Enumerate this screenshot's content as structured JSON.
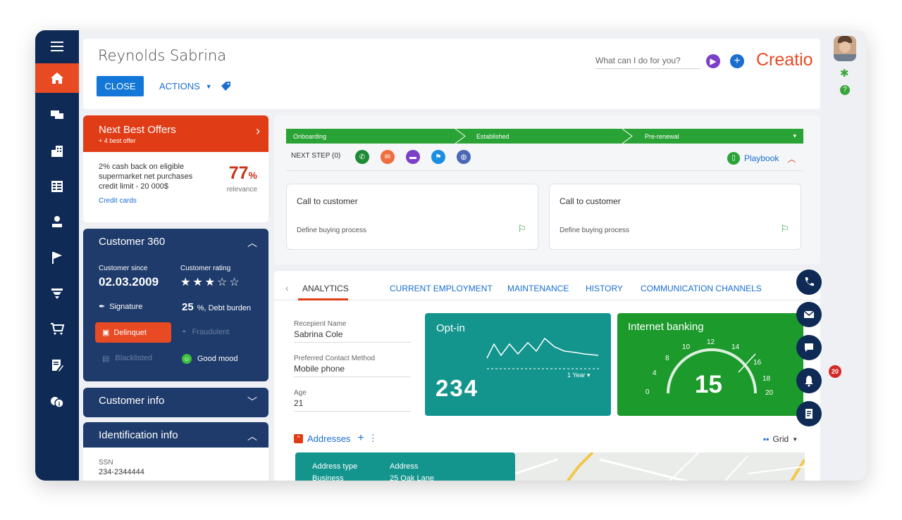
{
  "header": {
    "record_title": "Reynolds Sabrina",
    "close_label": "CLOSE",
    "actions_label": "ACTIONS",
    "search_placeholder": "What can I do for you?",
    "brand": "Creatio"
  },
  "nav": {
    "items": [
      "menu-icon",
      "home-icon",
      "feed-icon",
      "accounts-icon",
      "contacts-list-icon",
      "contact-icon",
      "flag-icon",
      "filter-icon",
      "cart-icon",
      "document-edit-icon",
      "dollar-icon"
    ],
    "active": "home-icon"
  },
  "next_best_offers": {
    "title": "Next Best Offers",
    "subtitle": "+ 4 best offer",
    "offer_text": "2% cash back on eligible supermarket net purchases credit limit - 20 000$",
    "percent": "77",
    "percent_unit": "%",
    "relevance_label": "relevance",
    "link": "Credit cards"
  },
  "customer360": {
    "title": "Customer 360",
    "since_label": "Customer since",
    "since_value": "02.03.2009",
    "rating_label": "Customer rating",
    "rating_stars": 3,
    "rating_max": 5,
    "signature_label": "Signature",
    "debt_value": "25",
    "debt_label": "%, Debt burden",
    "delinquent_label": "Delinquet",
    "fraudulent_label": "Fraudulent",
    "blacklisted_label": "Blacklisted",
    "mood_label": "Good mood"
  },
  "customer_info": {
    "title": "Customer info"
  },
  "identification_info": {
    "title": "Identification info",
    "ssn_label": "SSN",
    "ssn_value": "234-2344444"
  },
  "stages": {
    "items": [
      "Onboarding",
      "Established",
      "Pre-renewal"
    ],
    "next_step_label": "NEXT STEP (0)",
    "playbook_label": "Playbook",
    "tasks": [
      {
        "title": "Call to customer",
        "subtitle": "Define buying process"
      },
      {
        "title": "Call to customer",
        "subtitle": "Define buying process"
      }
    ]
  },
  "tabs": {
    "items": [
      "ANALYTICS",
      "CURRENT EMPLOYMENT",
      "MAINTENANCE",
      "HISTORY",
      "COMMUNICATION CHANNELS"
    ],
    "active": "ANALYTICS"
  },
  "analytics": {
    "fields": [
      {
        "label": "Recepient Name",
        "value": "Sabrina Cole"
      },
      {
        "label": "Preferred Contact Method",
        "value": "Mobile phone"
      },
      {
        "label": "Age",
        "value": "21"
      }
    ],
    "optin": {
      "title": "Opt-in",
      "value": "234",
      "period": "1 Year"
    },
    "internet_banking": {
      "title": "Internet banking",
      "value": "15",
      "ticks": [
        "0",
        "4",
        "8",
        "10",
        "12",
        "14",
        "16",
        "18",
        "20"
      ]
    }
  },
  "addresses": {
    "title": "Addresses",
    "view_label": "Grid",
    "col_type": "Address type",
    "col_address": "Address",
    "row_type": "Business",
    "row_address": "25 Oak Lane"
  },
  "right_rail": {
    "badge_count": "20"
  },
  "colors": {
    "nav_bg": "#0e2a55",
    "accent": "#e84a23",
    "link": "#1a6ed0",
    "stage_green": "#2aa336",
    "teal": "#13958e",
    "green_tile": "#1c9a2c"
  }
}
